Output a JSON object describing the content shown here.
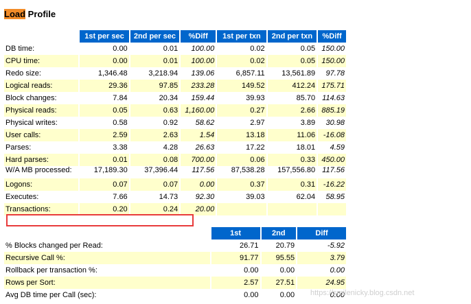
{
  "heading": {
    "highlight": "Load",
    "rest": " Profile"
  },
  "load_profile": {
    "columns": [
      "",
      "1st per sec",
      "2nd per sec",
      "%Diff",
      "1st per txn",
      "2nd per txn",
      "%Diff"
    ],
    "rows": [
      {
        "label": "DB time:",
        "v": [
          "0.00",
          "0.01",
          "100.00",
          "0.02",
          "0.05",
          "150.00"
        ]
      },
      {
        "label": "CPU time:",
        "v": [
          "0.00",
          "0.01",
          "100.00",
          "0.02",
          "0.05",
          "150.00"
        ]
      },
      {
        "label": "Redo size:",
        "v": [
          "1,346.48",
          "3,218.94",
          "139.06",
          "6,857.11",
          "13,561.89",
          "97.78"
        ]
      },
      {
        "label": "Logical reads:",
        "v": [
          "29.36",
          "97.85",
          "233.28",
          "149.52",
          "412.24",
          "175.71"
        ]
      },
      {
        "label": "Block changes:",
        "v": [
          "7.84",
          "20.34",
          "159.44",
          "39.93",
          "85.70",
          "114.63"
        ]
      },
      {
        "label": "Physical reads:",
        "v": [
          "0.05",
          "0.63",
          "1,160.00",
          "0.27",
          "2.66",
          "885.19"
        ]
      },
      {
        "label": "Physical writes:",
        "v": [
          "0.58",
          "0.92",
          "58.62",
          "2.97",
          "3.89",
          "30.98"
        ]
      },
      {
        "label": "User calls:",
        "v": [
          "2.59",
          "2.63",
          "1.54",
          "13.18",
          "11.06",
          "-16.08"
        ]
      },
      {
        "label": "Parses:",
        "v": [
          "3.38",
          "4.28",
          "26.63",
          "17.22",
          "18.01",
          "4.59"
        ]
      },
      {
        "label": "Hard parses:",
        "v": [
          "0.01",
          "0.08",
          "700.00",
          "0.06",
          "0.33",
          "450.00"
        ]
      },
      {
        "label": "W/A MB processed:",
        "v": [
          "17,189.30",
          "37,396.44",
          "117.56",
          "87,538.28",
          "157,556.80",
          "117.56"
        ]
      },
      {
        "label": "Logons:",
        "v": [
          "0.07",
          "0.07",
          "0.00",
          "0.37",
          "0.31",
          "-16.22"
        ]
      },
      {
        "label": "Executes:",
        "v": [
          "7.66",
          "14.73",
          "92.30",
          "39.03",
          "62.04",
          "58.95"
        ]
      },
      {
        "label": "Transactions:",
        "v": [
          "0.20",
          "0.24",
          "20.00",
          "",
          "",
          ""
        ]
      }
    ]
  },
  "efficiency": {
    "columns": [
      "1st",
      "2nd",
      "Diff"
    ],
    "rows": [
      {
        "label": "% Blocks changed per Read:",
        "v": [
          "26.71",
          "20.79",
          "-5.92"
        ]
      },
      {
        "label": "Recursive Call %:",
        "v": [
          "91.77",
          "95.55",
          "3.79"
        ]
      },
      {
        "label": "Rollback per transaction %:",
        "v": [
          "0.00",
          "0.00",
          "0.00"
        ]
      },
      {
        "label": "Rows per Sort:",
        "v": [
          "2.57",
          "27.51",
          "24.95"
        ]
      },
      {
        "label": "Avg DB time per Call (sec):",
        "v": [
          "0.00",
          "0.00",
          "0.00"
        ]
      }
    ]
  },
  "watermark": "https://smilenicky.blog.csdn.net"
}
